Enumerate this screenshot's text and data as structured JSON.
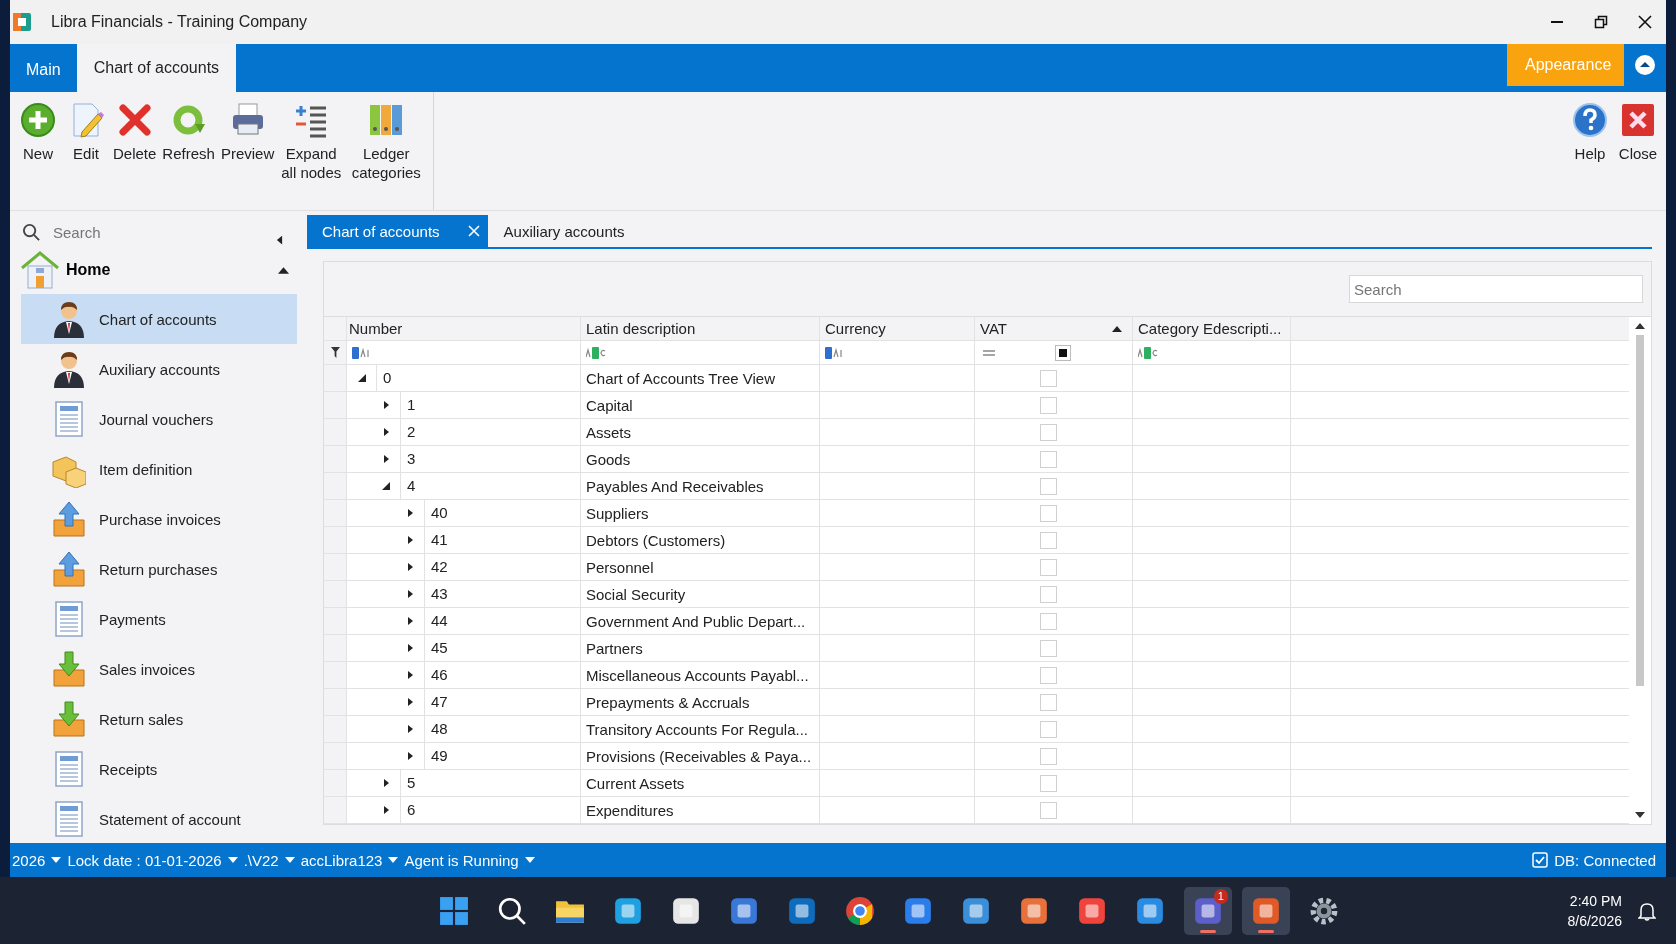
{
  "window": {
    "title": "Libra Financials - Training Company"
  },
  "ribbon_tabs": [
    {
      "label": "Main",
      "selected": false
    },
    {
      "label": "Chart of accounts",
      "selected": true
    }
  ],
  "appearance_button": "Appearance",
  "toolbar": [
    {
      "kind": "new",
      "label": "New"
    },
    {
      "kind": "edit",
      "label": "Edit"
    },
    {
      "kind": "delete",
      "label": "Delete"
    },
    {
      "kind": "refresh",
      "label": "Refresh"
    },
    {
      "kind": "preview",
      "label": "Preview"
    },
    {
      "kind": "expand",
      "label": "Expand all nodes"
    },
    {
      "kind": "ledger",
      "label": "Ledger categories"
    }
  ],
  "toolbar_right": [
    {
      "kind": "help",
      "label": "Help"
    },
    {
      "kind": "close",
      "label": "Close"
    }
  ],
  "sidebar": {
    "search": {
      "placeholder": "Search"
    },
    "section": "Home",
    "items": [
      {
        "kind": "person",
        "label": "Chart of accounts",
        "selected": true
      },
      {
        "kind": "person",
        "label": "Auxiliary accounts",
        "selected": false
      },
      {
        "kind": "sheet",
        "label": "Journal vouchers",
        "selected": false
      },
      {
        "kind": "boxes",
        "label": "Item definition",
        "selected": false
      },
      {
        "kind": "tray-up",
        "label": "Purchase invoices",
        "selected": false
      },
      {
        "kind": "tray-up",
        "label": "Return purchases",
        "selected": false
      },
      {
        "kind": "sheet",
        "label": "Payments",
        "selected": false
      },
      {
        "kind": "tray-down",
        "label": "Sales invoices",
        "selected": false
      },
      {
        "kind": "tray-down",
        "label": "Return sales",
        "selected": false
      },
      {
        "kind": "sheet",
        "label": "Receipts",
        "selected": false
      },
      {
        "kind": "sheet",
        "label": "Statement of account",
        "selected": false
      }
    ]
  },
  "doc_tabs": [
    {
      "label": "Chart of accounts",
      "selected": true,
      "closable": true
    },
    {
      "label": "Auxiliary accounts",
      "selected": false,
      "closable": false
    }
  ],
  "grid": {
    "search": {
      "placeholder": "Search"
    },
    "columns": [
      {
        "label": "Number",
        "kind": "text"
      },
      {
        "label": "Latin description",
        "kind": "text-like"
      },
      {
        "label": "Currency",
        "kind": "text"
      },
      {
        "label": "VAT",
        "kind": "check",
        "sorted": true
      },
      {
        "label": "Category Edescripti...",
        "kind": "text-like"
      }
    ],
    "rows": [
      {
        "number": "0",
        "description": "Chart of Accounts Tree View",
        "vat": false,
        "expanded": true,
        "children": [
          {
            "number": "1",
            "description": "Capital",
            "vat": false,
            "expanded": false
          },
          {
            "number": "2",
            "description": "Assets",
            "vat": false,
            "expanded": false
          },
          {
            "number": "3",
            "description": "Goods",
            "vat": false,
            "expanded": false
          },
          {
            "number": "4",
            "description": "Payables And Receivables",
            "vat": false,
            "expanded": true,
            "children": [
              {
                "number": "40",
                "description": "Suppliers",
                "vat": false,
                "expanded": false
              },
              {
                "number": "41",
                "description": "Debtors (Customers)",
                "vat": false,
                "expanded": false
              },
              {
                "number": "42",
                "description": "Personnel",
                "vat": false,
                "expanded": false
              },
              {
                "number": "43",
                "description": "Social Security",
                "vat": false,
                "expanded": false
              },
              {
                "number": "44",
                "description": "Government And Public Depart...",
                "vat": false,
                "expanded": false
              },
              {
                "number": "45",
                "description": "Partners",
                "vat": false,
                "expanded": false
              },
              {
                "number": "46",
                "description": "Miscellaneous Accounts Payabl...",
                "vat": false,
                "expanded": false
              },
              {
                "number": "47",
                "description": "Prepayments & Accruals",
                "vat": false,
                "expanded": false
              },
              {
                "number": "48",
                "description": "Transitory Accounts For Regula...",
                "vat": false,
                "expanded": false
              },
              {
                "number": "49",
                "description": "Provisions (Receivables & Paya...",
                "vat": false,
                "expanded": false
              }
            ]
          },
          {
            "number": "5",
            "description": "Current Assets",
            "vat": false,
            "expanded": false
          },
          {
            "number": "6",
            "description": "Expenditures",
            "vat": false,
            "expanded": false
          }
        ]
      }
    ]
  },
  "status_bar": {
    "items": [
      "2026",
      "Lock date : 01-01-2026",
      ".\\V22",
      "accLibra123",
      "Agent is Running"
    ],
    "db_checked": true,
    "db_label": "DB: Connected"
  },
  "taskbar": {
    "apps": [
      {
        "kind": "start",
        "running": false
      },
      {
        "kind": "search",
        "running": false
      },
      {
        "kind": "folder",
        "running": false
      },
      {
        "kind": "edge",
        "running": false
      },
      {
        "kind": "store",
        "running": false
      },
      {
        "kind": "mail",
        "running": false
      },
      {
        "kind": "outlook",
        "running": false
      },
      {
        "kind": "chrome",
        "running": false
      },
      {
        "kind": "stack",
        "running": false
      },
      {
        "kind": "photos",
        "running": false
      },
      {
        "kind": "spark",
        "running": false
      },
      {
        "kind": "anydesk",
        "running": false
      },
      {
        "kind": "vscode",
        "running": false
      },
      {
        "kind": "teams",
        "running": true,
        "badge": "1"
      },
      {
        "kind": "libra",
        "running": true
      },
      {
        "kind": "settings",
        "running": false
      }
    ],
    "time": "2:40 PM",
    "date": "8/6/2026"
  }
}
